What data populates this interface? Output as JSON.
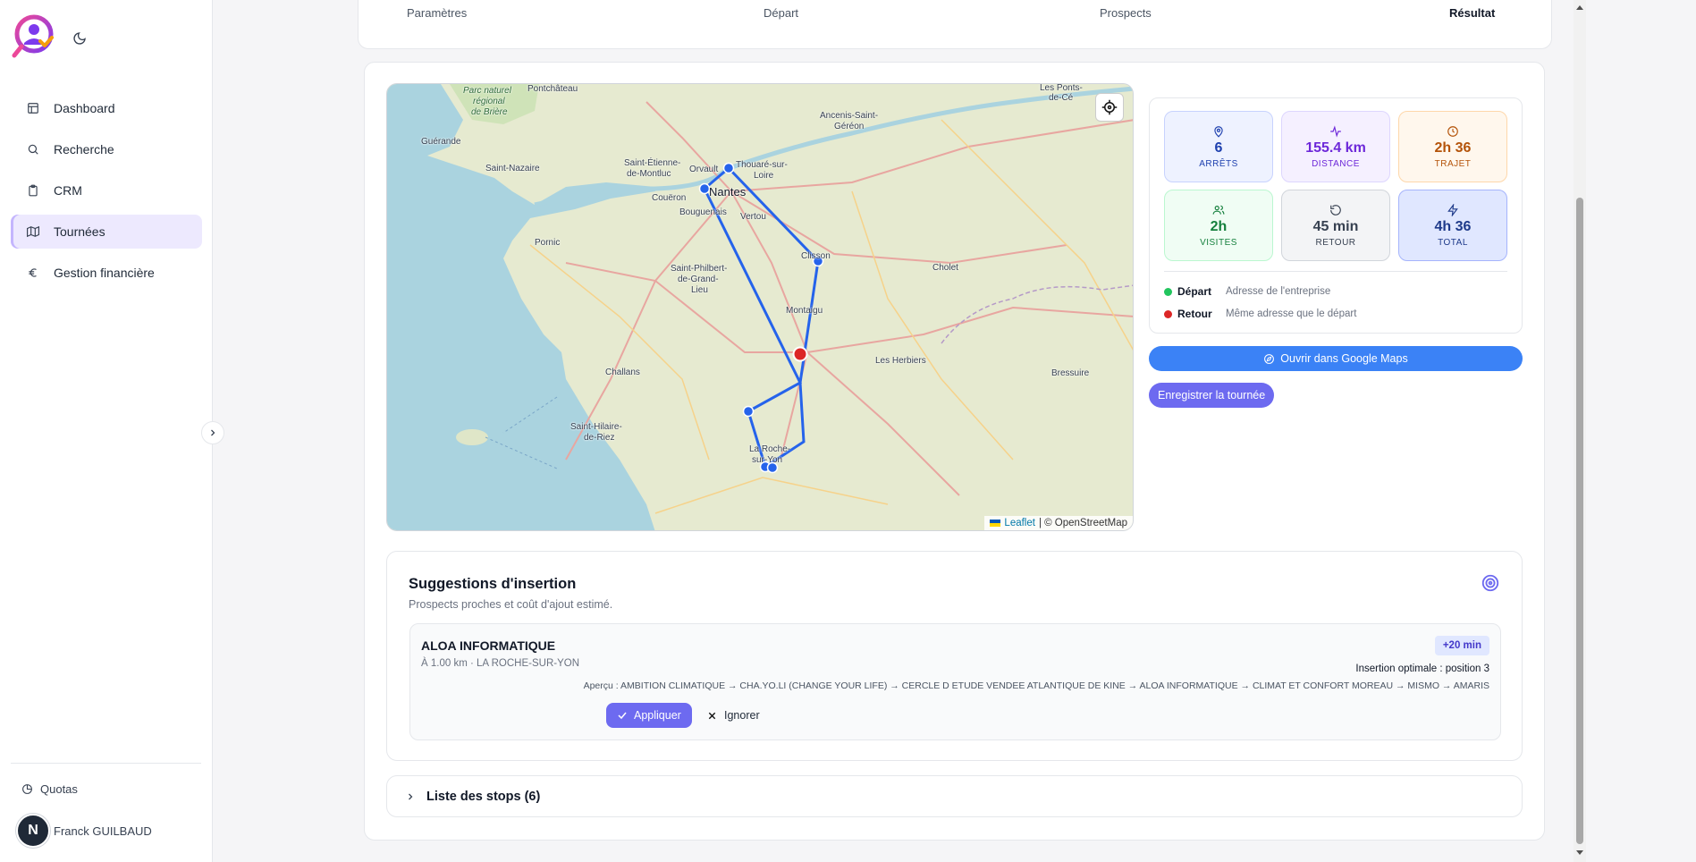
{
  "sidebar": {
    "items": [
      {
        "label": "Dashboard",
        "icon": "dashboard-icon"
      },
      {
        "label": "Recherche",
        "icon": "search-icon"
      },
      {
        "label": "CRM",
        "icon": "clipboard-icon"
      },
      {
        "label": "Tournées",
        "icon": "map-icon",
        "active": true
      },
      {
        "label": "Gestion financière",
        "icon": "euro-icon"
      }
    ],
    "quotas": "Quotas",
    "user_initial": "N",
    "user_name": "Franck GUILBAUD"
  },
  "stepper": {
    "steps": [
      "Paramètres",
      "Départ",
      "Prospects",
      "Résultat"
    ],
    "current": "Résultat"
  },
  "map": {
    "labels": [
      "Parc naturel",
      "régional",
      "de Brière",
      "Pontchâteau",
      "Les Ponts-",
      "de-Cé",
      "Ancenis-Saint-",
      "Géréon",
      "Guérande",
      "Saint-Nazaire",
      "Saint-Étienne-",
      "de-Montluc",
      "Orvault",
      "Thouaré-sur-",
      "Loire",
      "Nantes",
      "Couëron",
      "Bouguenais",
      "Vertou",
      "Pornic",
      "Clisson",
      "Cholet",
      "Saint-Philbert-",
      "de-Grand-",
      "Lieu",
      "Montaigu",
      "Les Herbiers",
      "Challans",
      "Bressuire",
      "Saint-Hilaire-",
      "de-Riez",
      "La Roche-",
      "sur-Yon"
    ],
    "attribution_leaflet": "Leaflet",
    "attribution_osm": "| © OpenStreetMap"
  },
  "stats": {
    "arrets": {
      "value": "6",
      "label": "ARRÊTS"
    },
    "distance": {
      "value": "155.4 km",
      "label": "DISTANCE"
    },
    "trajet": {
      "value": "2h 36",
      "label": "TRAJET"
    },
    "visites": {
      "value": "2h",
      "label": "VISITES"
    },
    "retour": {
      "value": "45 min",
      "label": "RETOUR"
    },
    "total": {
      "value": "4h 36",
      "label": "TOTAL"
    },
    "depart_label": "Départ",
    "depart_value": "Adresse de l'entreprise",
    "retour_label": "Retour",
    "retour_value": "Même adresse que le départ",
    "colors": {
      "depart": "#22c55e",
      "retour": "#dc2626"
    }
  },
  "actions": {
    "gmaps": "Ouvrir dans Google Maps",
    "save": "Enregistrer la tournée"
  },
  "suggestions": {
    "title": "Suggestions d'insertion",
    "subtitle": "Prospects proches et coût d'ajout estimé.",
    "item": {
      "name": "ALOA INFORMATIQUE",
      "distance": "À 1.00 km · LA ROCHE-SUR-YON",
      "badge": "+20 min",
      "position": "Insertion optimale : position 3",
      "preview": "Aperçu : AMBITION CLIMATIQUE → CHA.YO.LI (CHANGE YOUR LIFE) → CERCLE D ETUDE VENDEE ATLANTIQUE DE KINE → ALOA INFORMATIQUE → CLIMAT ET CONFORT MOREAU → MISMO → AMARIS",
      "apply": "Appliquer",
      "ignore": "Ignorer"
    }
  },
  "stops_label": "Liste des stops (6)",
  "accent": "#6d6af0"
}
